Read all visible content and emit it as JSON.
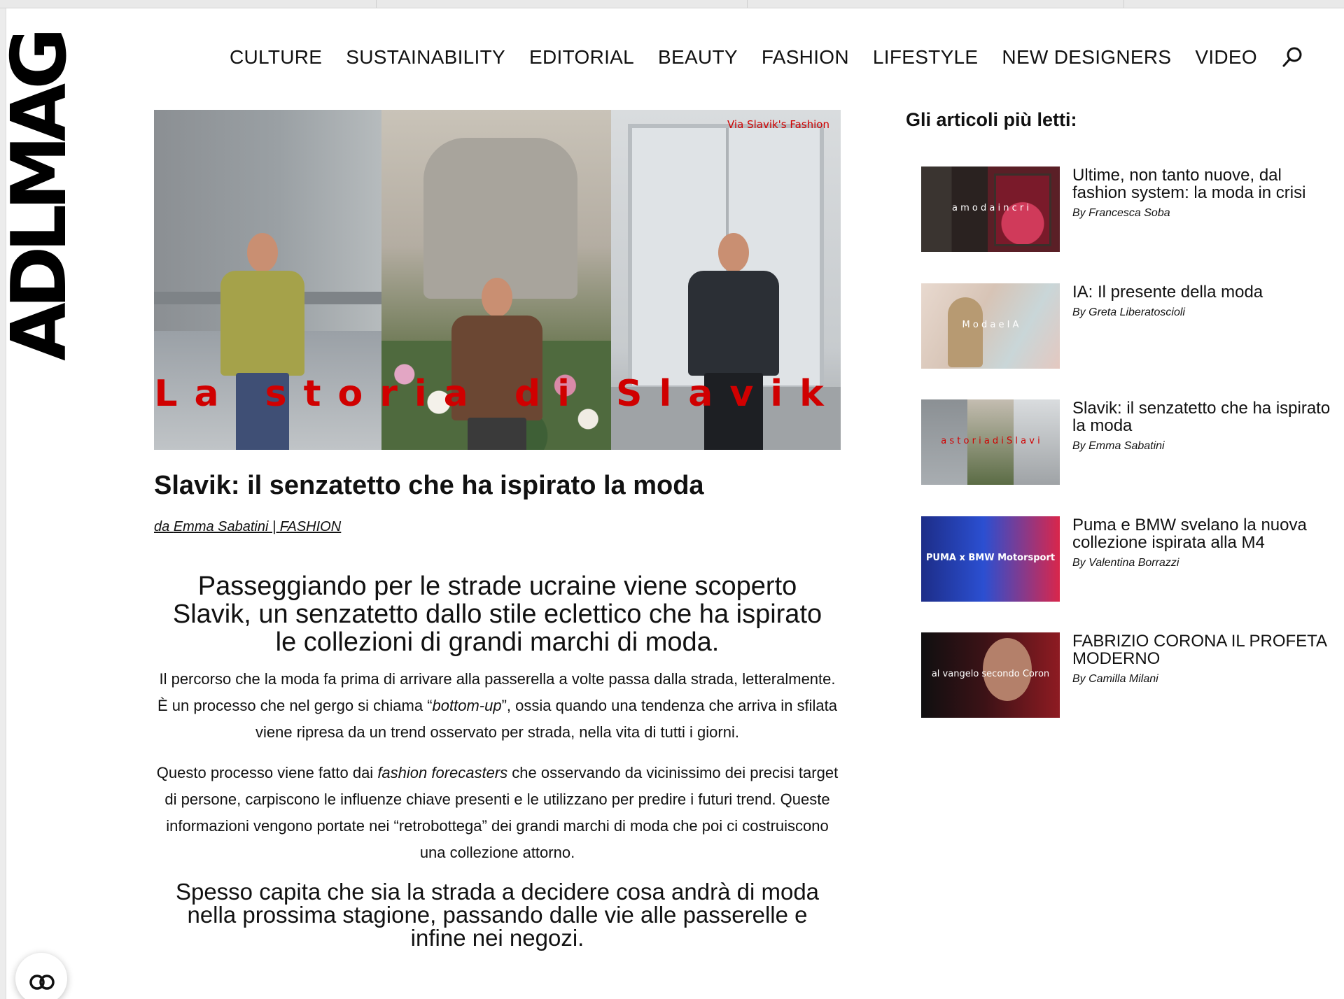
{
  "site": {
    "logo": "ADLMAG"
  },
  "nav": {
    "items": [
      "CULTURE",
      "SUSTAINABILITY",
      "EDITORIAL",
      "BEAUTY",
      "FASHION",
      "LIFESTYLE",
      "NEW DESIGNERS",
      "VIDEO"
    ],
    "search_icon": "search-icon"
  },
  "hero": {
    "caption": "La storia di Slavik",
    "credit": "Via Slavik's Fashion"
  },
  "article": {
    "title": "Slavik: il senzatetto che ha ispirato la moda",
    "byline_prefix": "da ",
    "author": "Emma Sabatini",
    "byline_sep": " | ",
    "category": "FASHION",
    "lead": "Passeggiando per le strade ucraine viene scoperto Slavik, un senzatetto dallo stile eclettico che ha ispirato le collezioni di grandi marchi di moda.",
    "p1_a": "Il percorso che la moda fa prima di arrivare alla passerella a volte passa dalla strada, letteralmente. È un processo che nel gergo si chiama “",
    "p1_em": "bottom-up",
    "p1_b": "”, ossia quando una tendenza che arriva in sfilata viene ripresa da un trend osservato per strada, nella vita di tutti i giorni.",
    "p2_a": "Questo processo viene fatto dai ",
    "p2_em": "fashion forecasters",
    "p2_b": " che osservando da vicinissimo dei precisi target di persone, carpiscono le influenze chiave presenti e le utilizzano per predire i futuri trend. Queste informazioni vengono portate nei “retrobottega” dei grandi marchi di moda che poi ci costruiscono una collezione attorno.",
    "subhead": "Spesso capita che sia la strada a decidere cosa andrà di moda nella prossima stagione, passando dalle vie alle passerelle e infine nei negozi."
  },
  "sidebar": {
    "title": "Gli articoli più letti:",
    "items": [
      {
        "title": "Ultime, non tanto nuove, dal fashion system: la moda in crisi",
        "author": "By Francesca Soba",
        "thumb_label": "a  m o d a  i n  c r i"
      },
      {
        "title": "IA: Il presente della moda",
        "author": "By Greta Liberatoscioli",
        "thumb_label": "M o d a  e  I A"
      },
      {
        "title": "Slavik: il senzatetto che ha ispirato la moda",
        "author": "By Emma Sabatini",
        "thumb_label": "a  s t o r i a  d i  S l a v i"
      },
      {
        "title": "Puma e BMW svelano la nuova collezione ispirata alla M4",
        "author": "By Valentina Borrazzi",
        "thumb_label": "PUMA x BMW Motorsport"
      },
      {
        "title": "FABRIZIO CORONA IL PROFETA MODERNO",
        "author": "By Camilla Milani",
        "thumb_label": "al vangelo secondo Coron"
      }
    ]
  },
  "colors": {
    "accent_red": "#d00000",
    "text": "#111111"
  },
  "widgets": {
    "chat_icon": "chat-icon"
  }
}
